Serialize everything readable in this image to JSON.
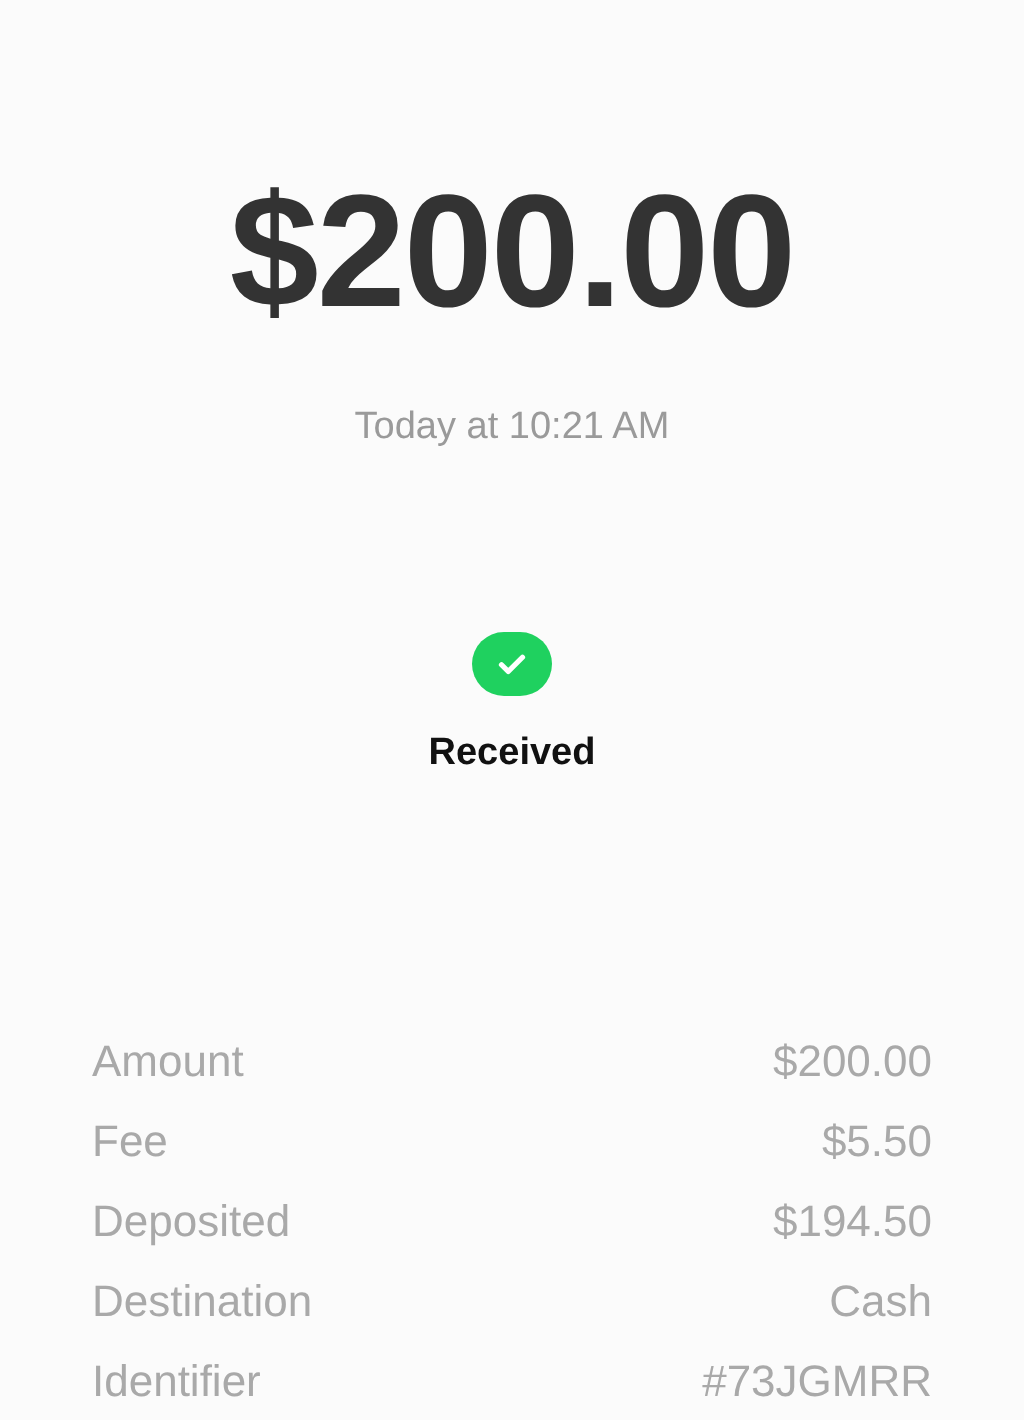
{
  "amount": "$200.00",
  "timestamp": "Today at 10:21 AM",
  "status": {
    "label": "Received",
    "kind": "success"
  },
  "details": [
    {
      "label": "Amount",
      "value": "$200.00"
    },
    {
      "label": "Fee",
      "value": "$5.50"
    },
    {
      "label": "Deposited",
      "value": "$194.50"
    },
    {
      "label": "Destination",
      "value": "Cash"
    },
    {
      "label": "Identifier",
      "value": "#73JGMRR"
    }
  ]
}
